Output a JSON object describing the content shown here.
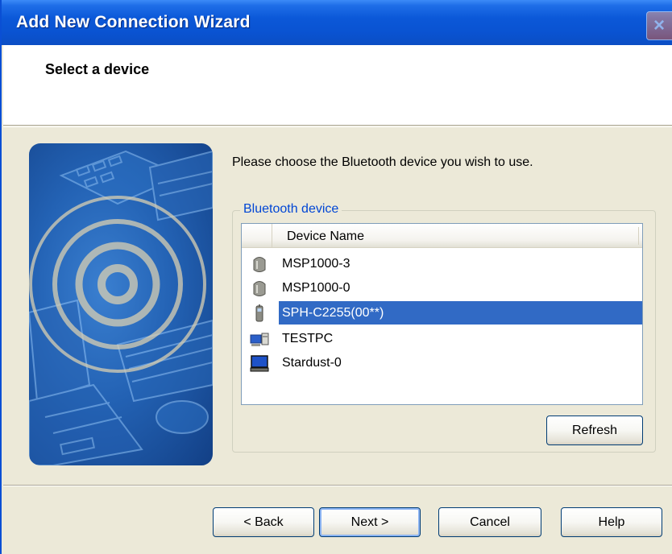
{
  "window": {
    "title": "Add New Connection Wizard",
    "close_glyph": "×"
  },
  "header": {
    "title": "Select a device"
  },
  "content": {
    "instruction": "Please choose the Bluetooth device you wish to use.",
    "group_label": "Bluetooth device",
    "list": {
      "column_header": "Device Name",
      "items": [
        {
          "label": "MSP1000-3",
          "icon": "headset-icon",
          "selected": false
        },
        {
          "label": "MSP1000-0",
          "icon": "headset-icon",
          "selected": false
        },
        {
          "label": "SPH-C2255(00**)",
          "icon": "phone-icon",
          "selected": true
        },
        {
          "label": "TESTPC",
          "icon": "desktop-computer-icon",
          "selected": false
        },
        {
          "label": "Stardust-0",
          "icon": "monitor-icon",
          "selected": false
        }
      ]
    },
    "refresh_label": "Refresh"
  },
  "footer": {
    "back_label": "< Back",
    "next_label": "Next >",
    "cancel_label": "Cancel",
    "help_label": "Help"
  },
  "colors": {
    "titlebar": "#0a53d2",
    "selection": "#316ac5",
    "group_label": "#0046d5",
    "dialog_bg": "#ece9d8"
  }
}
